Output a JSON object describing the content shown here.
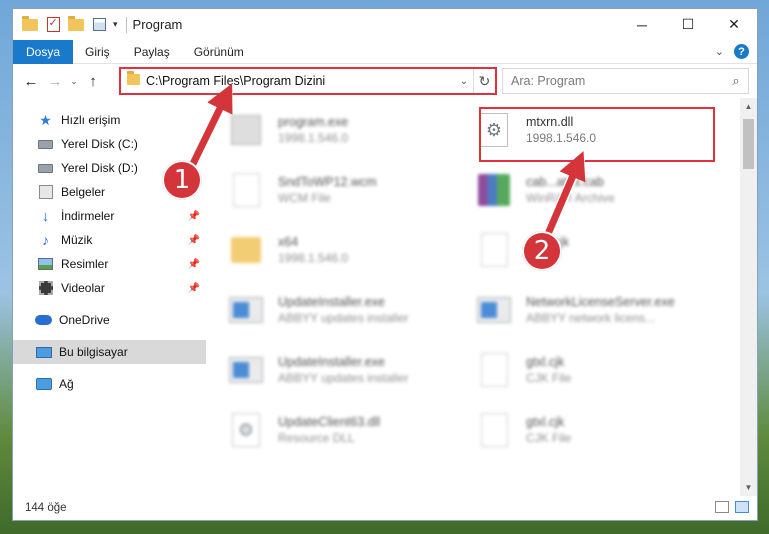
{
  "window": {
    "title": "Program",
    "controls": {
      "minimize": "─",
      "maximize": "☐",
      "close": "✕"
    }
  },
  "ribbon": {
    "tabs": [
      "Dosya",
      "Giriş",
      "Paylaş",
      "Görünüm"
    ],
    "help": "?"
  },
  "address": {
    "path": "C:\\Program Files\\Program Dizini",
    "search_placeholder": "Ara: Program"
  },
  "nav_pane": {
    "items": [
      {
        "label": "Hızlı erişim",
        "icon": "star-icon"
      },
      {
        "label": "Yerel Disk (C:)",
        "icon": "disk-icon"
      },
      {
        "label": "Yerel Disk (D:)",
        "icon": "disk-icon"
      },
      {
        "label": "Belgeler",
        "icon": "documents-icon"
      },
      {
        "label": "İndirmeler",
        "icon": "download-icon"
      },
      {
        "label": "Müzik",
        "icon": "music-icon"
      },
      {
        "label": "Resimler",
        "icon": "pictures-icon"
      },
      {
        "label": "Videolar",
        "icon": "videos-icon"
      },
      {
        "label": "OneDrive",
        "icon": "cloud-icon"
      },
      {
        "label": "Bu bilgisayar",
        "icon": "computer-icon"
      },
      {
        "label": "Ağ",
        "icon": "network-icon"
      }
    ]
  },
  "files": [
    {
      "name": "program.exe",
      "desc": "1998.1.546.0"
    },
    {
      "name": "mtxrn.dll",
      "desc": "1998.1.546.0"
    },
    {
      "name": "SndToWP12.wcm",
      "desc": "WCM File"
    },
    {
      "name": "cab...ates.cab",
      "desc": "WinRAR Archive"
    },
    {
      "name": "x64",
      "desc": "1998.1.546.0"
    },
    {
      "name": "...an.cjk",
      "desc": "...e"
    },
    {
      "name": "UpdateInstaller.exe",
      "desc": "ABBYY updates installer"
    },
    {
      "name": "NetworkLicenseServer.exe",
      "desc": "ABBYY network licens..."
    },
    {
      "name": "UpdateInstaller.exe",
      "desc": "ABBYY updates installer"
    },
    {
      "name": "gtxl.cjk",
      "desc": "CJK File"
    },
    {
      "name": "UpdateClient63.dll",
      "desc": "Resource DLL"
    },
    {
      "name": "gtxl.cjk",
      "desc": "CJK File"
    }
  ],
  "status": {
    "count": "144 öğe"
  },
  "annotations": {
    "badge1": "1",
    "badge2": "2"
  },
  "colors": {
    "accent": "#1979ca",
    "highlight": "#e0313e",
    "badge": "#d3353a"
  }
}
